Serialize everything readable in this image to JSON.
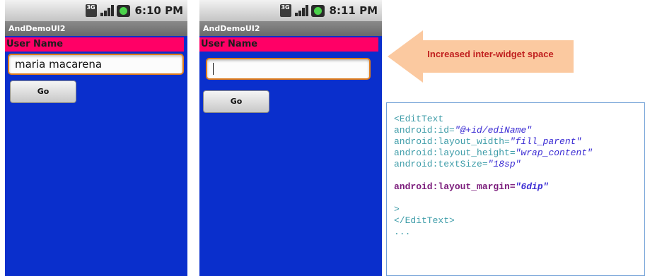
{
  "phones": [
    {
      "clock": "6:10 PM",
      "app_title": "AndDemoUI2",
      "label": "User Name",
      "edittext_value": "maria macarena",
      "button_label": "Go"
    },
    {
      "clock": "8:11 PM",
      "app_title": "AndDemoUI2",
      "label": "User Name",
      "edittext_value": "",
      "button_label": "Go"
    }
  ],
  "status_icons": {
    "network": "3G",
    "network_icon": "network-3g-icon",
    "signal_icon": "signal-bars-icon",
    "battery_icon": "battery-icon"
  },
  "callout": {
    "text": "Increased inter-widget space",
    "arrow_fill": "#fbc9a0",
    "text_color": "#c0201f"
  },
  "code": {
    "open_tag": "<EditText",
    "id_attr": "android:id=",
    "id_val": "\"@+id/ediName\"",
    "width_attr": "android:layout_width=",
    "width_val": "\"fill_parent\"",
    "height_attr": "android:layout_height=",
    "height_val": "\"wrap_content\"",
    "textsize_attr": "android:textSize=",
    "textsize_val": "\"18sp\"",
    "margin_attr": "android:layout_margin=",
    "margin_val": "\"6dip\"",
    "gt": ">",
    "close_tag": "</EditText>",
    "ellipsis": "..."
  },
  "colors": {
    "screen_bg": "#0a2fcc",
    "label_bg": "#ff0066",
    "edittext_border": "#e07d1c"
  }
}
